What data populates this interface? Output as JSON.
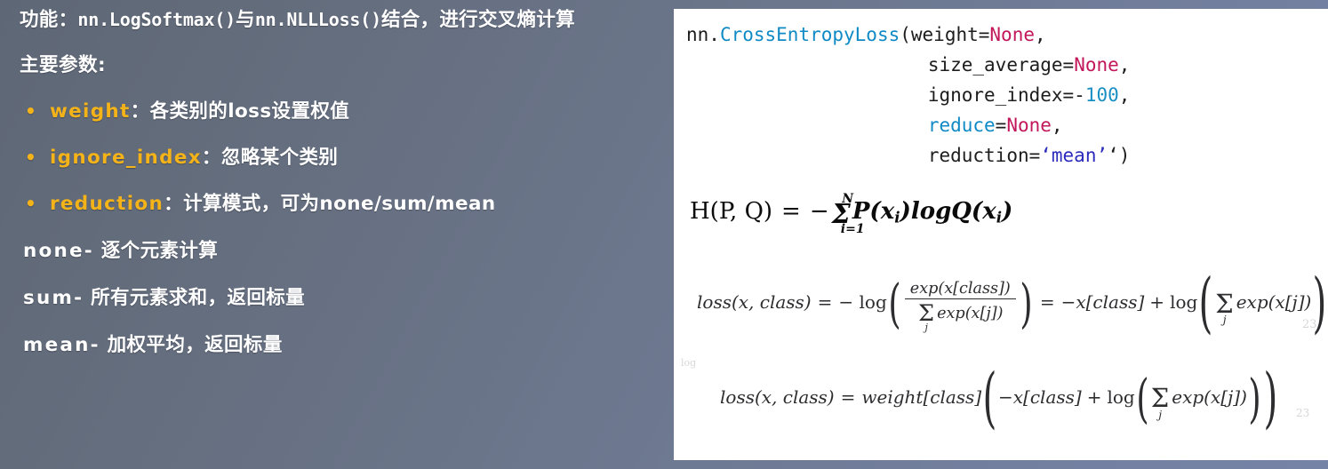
{
  "theme": {
    "bg_gradient_from": "#5e6776",
    "bg_gradient_to": "#7583a6",
    "panel_bg": "#ffffff",
    "accent_orange": "#f5b31a",
    "text_white": "#ffffff",
    "code_blue": "#0f8ac5",
    "code_magenta": "#c2185b",
    "code_number": "#1a8fc4",
    "code_string": "#2b2bbd",
    "code_plain": "#1d1d1d"
  },
  "left": {
    "lead": {
      "prefix": "功能：",
      "mono": "nn.LogSoftmax()",
      "mid": "与",
      "mono2": "nn.NLLLoss()",
      "suffix": "结合，进行交叉熵计算"
    },
    "section_head": "主要参数:",
    "bullets": [
      {
        "dot": "•",
        "key": "weight",
        "sep": "：",
        "desc": "各类别的loss设置权值"
      },
      {
        "dot": "•",
        "key": "ignore_index",
        "sep": "：",
        "desc": "忽略某个类别"
      },
      {
        "dot": "•",
        "key": "reduction",
        "sep": " ：",
        "desc": "计算模式，可为none/sum/mean"
      }
    ],
    "notes": [
      {
        "key": "none-",
        "desc": " 逐个元素计算"
      },
      {
        "key": "sum-",
        "desc": " 所有元素求和，返回标量"
      },
      {
        "key": "mean-",
        "desc": " 加权平均，返回标量"
      }
    ]
  },
  "right": {
    "code": {
      "line1": {
        "ns": "nn.",
        "fn": "CrossEntropyLoss",
        "paren": "(",
        "arg": "weight=",
        "val": "None",
        "tail": ","
      },
      "line2": {
        "arg": "size_average=",
        "val": "None",
        "tail": ","
      },
      "line3": {
        "arg": "ignore_index=-",
        "val": "100",
        "tail": ","
      },
      "line4": {
        "arg": "reduce",
        "eq": "=",
        "val": "None",
        "tail": ","
      },
      "line5": {
        "arg": "reduction=",
        "val": "‘mean’",
        "tail": "‘)"
      }
    },
    "formula_entropy": {
      "lhs": "H(P, Q)",
      "eq": "=",
      "minus": "−",
      "sum_glyph": "Σ",
      "sum_sup": "N",
      "sum_sub": "i=1",
      "body_p": "P(x",
      "body_p_sub": "i",
      "body_p_end": ")",
      "log": "logQ(x",
      "log_sub": "i",
      "log_end": ")",
      "plain": "H(P,Q) = − Σ_{i=1}^{N} P(x_i) log Q(x_i)"
    },
    "formula_loss_1": {
      "lhs": "loss(x, class)",
      "eq1": "=",
      "neg_log": "− log",
      "numerator": "exp(x[class])",
      "denominator_sum": "Σ",
      "denominator_sub": "j",
      "denominator_rest": "exp(x[j])",
      "eq2": "=",
      "rhs_first": "−x[class]",
      "plus": "+",
      "log": "log",
      "sum": "Σ",
      "sum_sub": "j",
      "sum_body": "exp(x[j])",
      "plain": "loss(x, class) = − log( exp(x[class]) / Σ_j exp(x[j]) ) = −x[class] + log( Σ_j exp(x[j]) )"
    },
    "formula_loss_2": {
      "lhs": "loss(x, class)",
      "eq": "=",
      "weight": "weight",
      "weight_idx": "[class]",
      "inner_first": "−x[class]",
      "plus": "+",
      "log": "log",
      "sum": "Σ",
      "sum_sub": "j",
      "sum_body": "exp(x[j])",
      "plain": "loss(x, class) = weight[class] ( −x[class] + log( Σ_j exp(x[j]) ) )"
    },
    "artifacts": {
      "top_left": "log",
      "right_1": "23",
      "right_2": "23"
    }
  }
}
